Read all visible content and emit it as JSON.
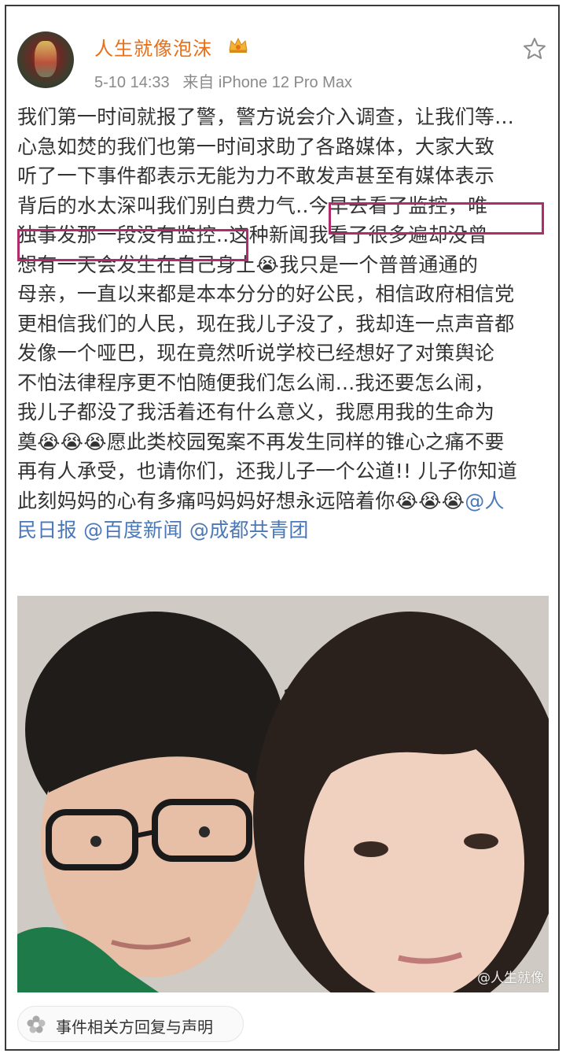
{
  "post": {
    "author": "人生就像泡沫",
    "timestamp": "5-10 14:33",
    "source": "来自 iPhone 12 Pro Max",
    "lines": [
      "我们第一时间就报了警，警方说会介入调查，让我们等...",
      "心急如焚的我们也第一时间求助了各路媒体，大家大致",
      "听了一下事件都表示无能为力不敢发声甚至有媒体表示",
      "背后的水太深叫我们别白费力气..今早去看了监控，唯",
      "独事发那一段没有监控..这种新闻我看了很多遍却没曾",
      "想有一天会发生在自己身上😭我只是一个普普通通的",
      "母亲，一直以来都是本本分分的好公民，相信政府相信党",
      "更相信我们的人民，现在我儿子没了，我却连一点声音都",
      "发像一个哑巴，现在竟然听说学校已经想好了对策舆论",
      "不怕法律程序更不怕随便我们怎么闹...我还要怎么闹，",
      "我儿子都没了我活着还有什么意义，我愿用我的生命为",
      "奠😭😭😭愿此类校园冤案不再发生同样的锥心之痛不要",
      "再有人承受，也请你们，还我儿子一个公道!! 儿子你知道",
      "此刻妈妈的心有多痛吗妈妈好想永远陪着你😭😭😭"
    ],
    "mention_tail": "@人",
    "mentions_line": "民日报 @百度新闻 @成都共青团",
    "photo_watermark": "@人生就像",
    "topic": "事件相关方回复与声明"
  },
  "icons": {
    "crown": "crown-badge-icon",
    "star": "favorite-star-icon",
    "topic": "topic-flower-icon"
  },
  "colors": {
    "username": "#e8701a",
    "mention": "#4a78b8",
    "highlight_box": "#b02c6a",
    "body_text": "#333333",
    "meta_text": "#8a8a8a"
  }
}
